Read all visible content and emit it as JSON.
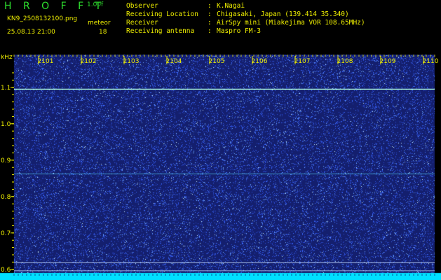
{
  "header": {
    "app_title": "HROFFT",
    "version": "1.00f",
    "file_name": "KN9_2508132100.png",
    "class_label": "meteor",
    "datetime": "25.08.13 21:00",
    "count": "18"
  },
  "station_info": [
    {
      "label": "Observer",
      "value": "K.Nagai"
    },
    {
      "label": "Receiving Location",
      "value": "Chigasaki, Japan (139.414 35.340)"
    },
    {
      "label": "Receiver",
      "value": "AirSpy mini (Miakejima VOR 108.65MHz)"
    },
    {
      "label": "Receiving antenna",
      "value": "Maspro FM-3"
    }
  ],
  "chart_data": {
    "type": "heatmap",
    "ylabel": "kHz",
    "y_ticks": [
      "1.1",
      "1.0",
      "0.9",
      "0.8",
      "0.7",
      "0.6"
    ],
    "x_ticks": [
      "2101",
      "2102",
      "2103",
      "2104",
      "2105",
      "2106",
      "2107",
      "2108",
      "2109",
      "2110"
    ],
    "ylim": [
      0.59,
      1.19
    ],
    "horizontal_lines_khz": [
      1.095,
      0.862,
      0.618,
      0.596
    ],
    "colors": {
      "background": "#141f6e",
      "noise": "#3c6cff",
      "signal": "#a0ffe0",
      "floor": "#00e0ff",
      "axis": "#f0f000"
    }
  }
}
